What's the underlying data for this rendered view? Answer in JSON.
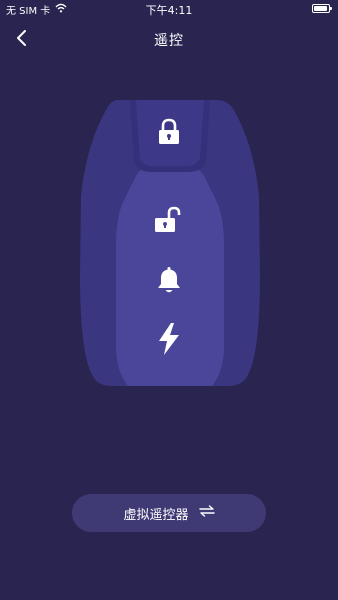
{
  "status": {
    "carrier": "无 SIM 卡",
    "time": "下午4:11"
  },
  "nav": {
    "title": "遥控"
  },
  "remote": {
    "buttons": [
      "lock",
      "unlock",
      "alarm",
      "start"
    ]
  },
  "bottom": {
    "label": "虚拟遥控器"
  },
  "colors": {
    "background": "#2a2550",
    "fob_outer": "#3a3680",
    "fob_inner": "#4a479a",
    "button_bg": "#3f3a73"
  }
}
